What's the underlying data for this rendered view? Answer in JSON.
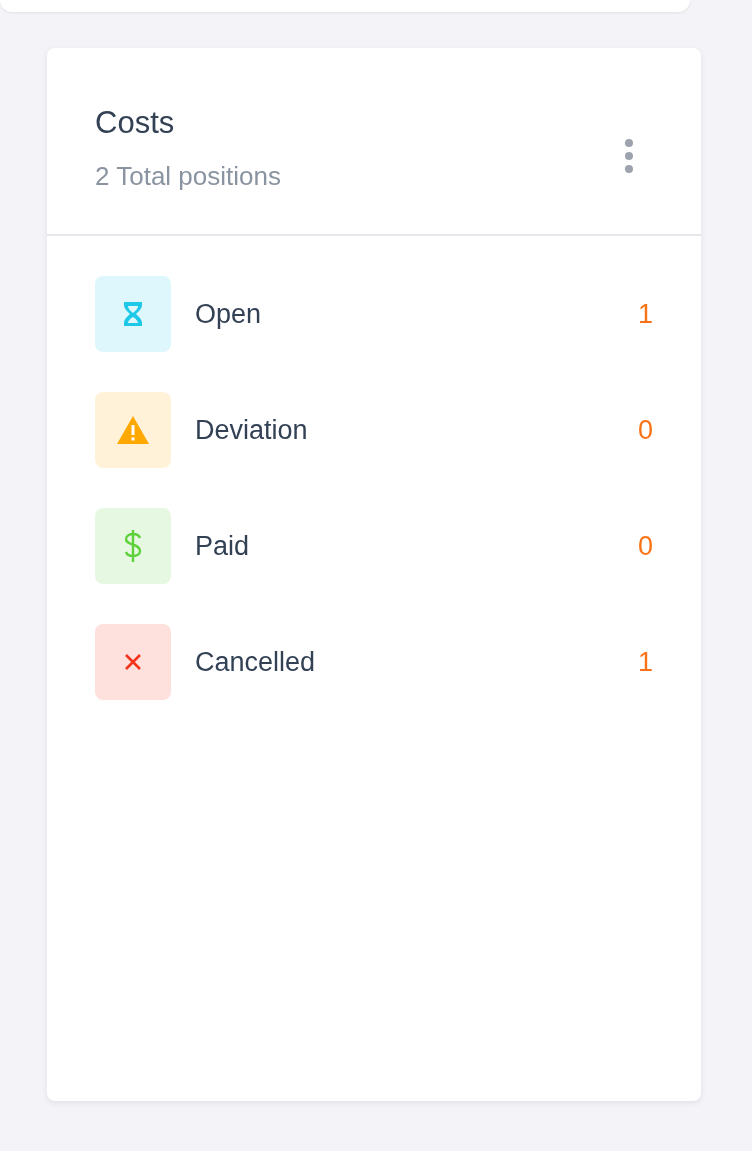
{
  "card": {
    "title": "Costs",
    "subtitle": "2 Total positions",
    "items": [
      {
        "kind": "open",
        "label": "Open",
        "count": "1",
        "color": "#1ec8e8"
      },
      {
        "kind": "deviation",
        "label": "Deviation",
        "count": "0",
        "color": "#ffa800"
      },
      {
        "kind": "paid",
        "label": "Paid",
        "count": "0",
        "color": "#5cd13a"
      },
      {
        "kind": "cancelled",
        "label": "Cancelled",
        "count": "1",
        "color": "#f5331c"
      }
    ]
  }
}
